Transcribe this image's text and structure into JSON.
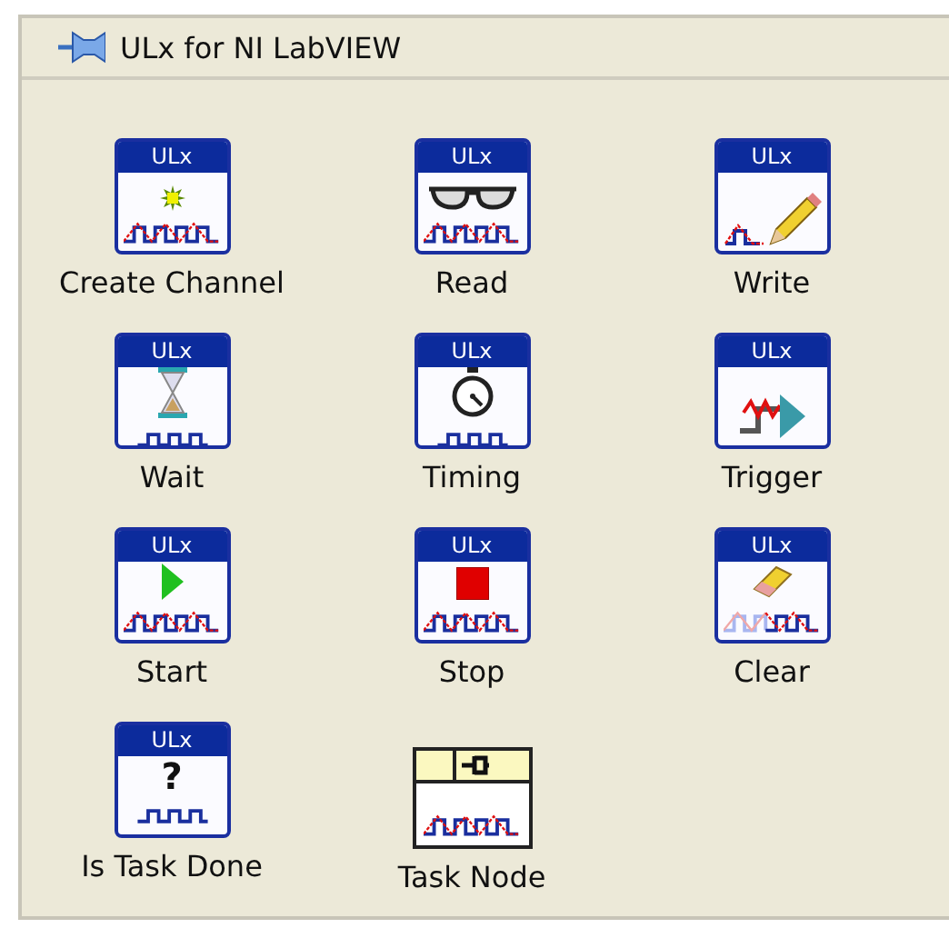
{
  "palette": {
    "title": "ULx for NI LabVIEW",
    "items": [
      {
        "label": "Create Channel",
        "badge": "ULx",
        "kind": "channel"
      },
      {
        "label": "Read",
        "badge": "ULx",
        "kind": "read"
      },
      {
        "label": "Write",
        "badge": "ULx",
        "kind": "write"
      },
      {
        "label": "Wait",
        "badge": "ULx",
        "kind": "wait"
      },
      {
        "label": "Timing",
        "badge": "ULx",
        "kind": "timing"
      },
      {
        "label": "Trigger",
        "badge": "ULx",
        "kind": "trigger"
      },
      {
        "label": "Start",
        "badge": "ULx",
        "kind": "start"
      },
      {
        "label": "Stop",
        "badge": "ULx",
        "kind": "stop"
      },
      {
        "label": "Clear",
        "badge": "ULx",
        "kind": "clear"
      },
      {
        "label": "Is Task Done",
        "badge": "ULx",
        "kind": "query",
        "glyph": "?"
      },
      {
        "label": "Task Node",
        "kind": "node"
      }
    ]
  }
}
